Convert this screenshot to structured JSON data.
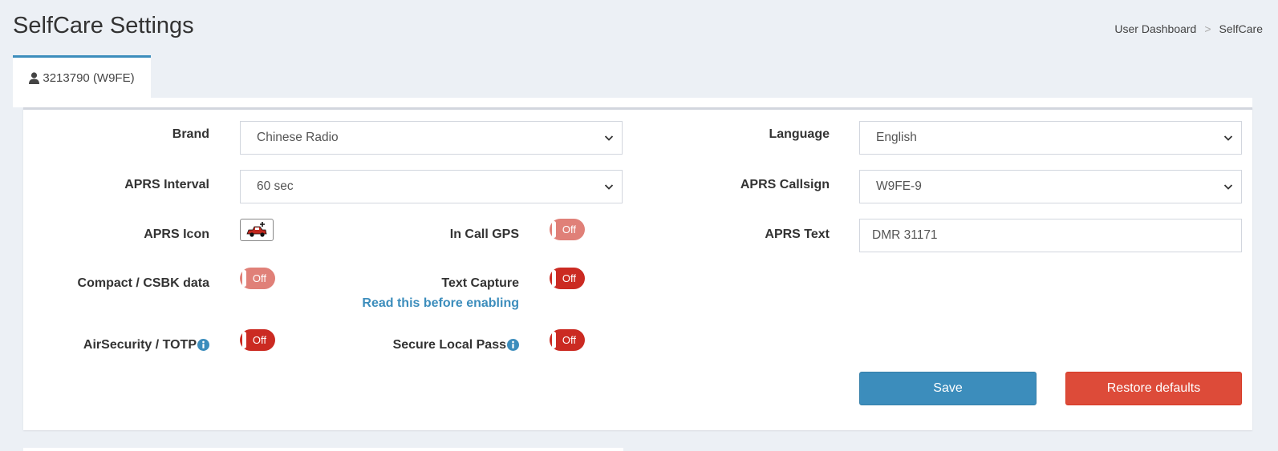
{
  "page": {
    "title": "SelfCare Settings"
  },
  "breadcrumb": {
    "items": [
      "User Dashboard",
      "SelfCare"
    ],
    "separator": ">"
  },
  "tab": {
    "label": "3213790 (W9FE)",
    "icon": "user-icon"
  },
  "fields": {
    "brand": {
      "label": "Brand",
      "value": "Chinese Radio"
    },
    "language": {
      "label": "Language",
      "value": "English"
    },
    "aprs_interval": {
      "label": "APRS Interval",
      "value": "60 sec"
    },
    "aprs_callsign": {
      "label": "APRS Callsign",
      "value": "W9FE-9"
    },
    "aprs_icon": {
      "label": "APRS Icon",
      "icon": "car-icon"
    },
    "in_call_gps": {
      "label": "In Call GPS",
      "state": "Off"
    },
    "aprs_text": {
      "label": "APRS Text",
      "value": "DMR 31171"
    },
    "compact_csbk": {
      "label": "Compact / CSBK data",
      "state": "Off"
    },
    "text_capture": {
      "label": "Text Capture",
      "state": "Off",
      "link": "Read this before enabling"
    },
    "air_security": {
      "label": "AirSecurity / TOTP",
      "state": "Off",
      "icon": "info-icon"
    },
    "secure_local_pass": {
      "label": "Secure Local Pass",
      "state": "Off",
      "icon": "info-icon"
    }
  },
  "buttons": {
    "save": "Save",
    "restore": "Restore defaults"
  },
  "colors": {
    "primary": "#3c8dbc",
    "danger": "#dd4b39",
    "toggle_off_light": "#e08078",
    "toggle_off_dark": "#cb2a22",
    "background": "#ecf0f5"
  }
}
